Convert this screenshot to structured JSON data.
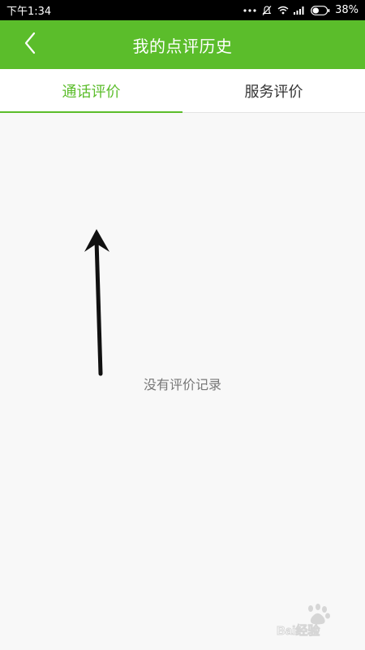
{
  "status_bar": {
    "time": "下午1:34",
    "battery": "38%"
  },
  "app_bar": {
    "title": "我的点评历史"
  },
  "tabs": [
    {
      "label": "通话评价",
      "active": true
    },
    {
      "label": "服务评价",
      "active": false
    }
  ],
  "empty_state": {
    "message": "没有评价记录"
  },
  "watermark": {
    "brand": "Bai经验"
  },
  "colors": {
    "accent": "#5bbd2b",
    "background": "#f8f8f8",
    "muted_text": "#777777"
  },
  "icons": [
    "back-arrow-icon",
    "more-dots-icon",
    "mute-bell-icon",
    "wifi-icon",
    "signal-icon",
    "battery-icon"
  ]
}
